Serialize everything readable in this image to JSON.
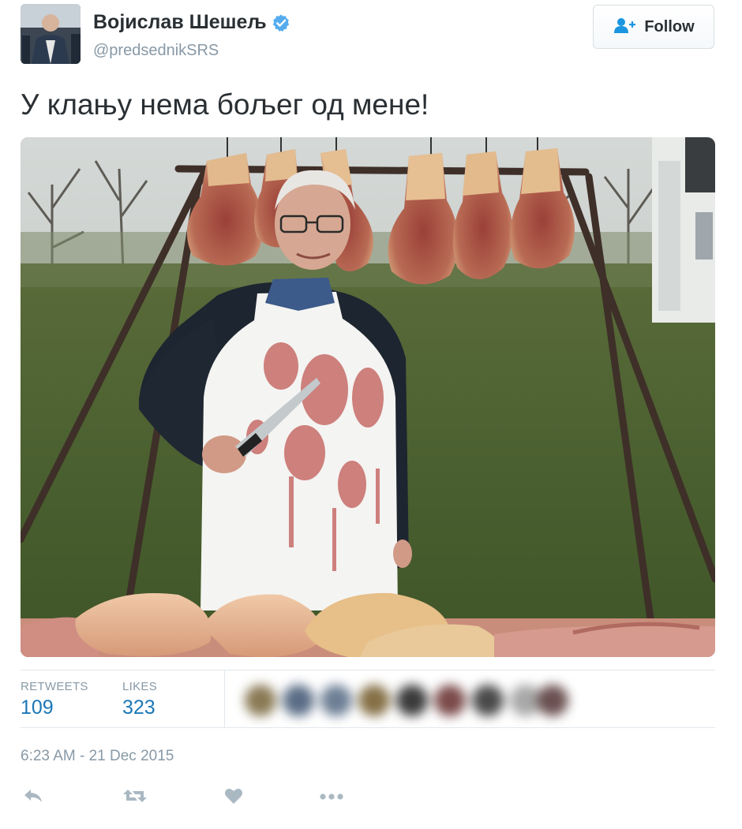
{
  "author": {
    "display_name": "Војислав Шешељ",
    "handle": "@predsednikSRS",
    "verified": true
  },
  "follow_button": {
    "label": "Follow",
    "icon": "follow-user-icon"
  },
  "tweet": {
    "text": "У клању нема бољег од мене!",
    "photo_icon": "tweet-photo"
  },
  "stats": {
    "retweets_label": "RETWEETS",
    "retweets_count": "109",
    "likes_label": "LIKES",
    "likes_count": "323"
  },
  "timestamp": "6:23 AM - 21 Dec 2015",
  "actions": [
    {
      "name": "reply",
      "icon": "reply-icon"
    },
    {
      "name": "retweet",
      "icon": "retweet-icon"
    },
    {
      "name": "like",
      "icon": "heart-icon"
    },
    {
      "name": "more",
      "icon": "more-icon"
    }
  ],
  "colors": {
    "link_blue": "#1b77b7",
    "verified_blue": "#55acee",
    "muted_text": "#8899a6",
    "action_icon": "#aab8c2"
  }
}
